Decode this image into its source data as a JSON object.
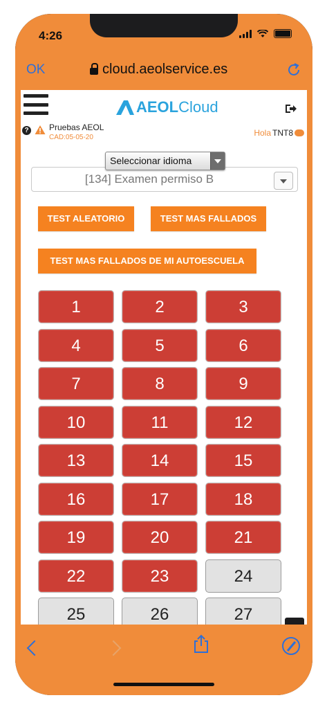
{
  "status_bar": {
    "time": "4:26"
  },
  "browser": {
    "ok_label": "OK",
    "url": "cloud.aeolservice.es"
  },
  "header": {
    "logo_text_bold": "AEOL",
    "logo_text_light": "Cloud",
    "school_name": "Pruebas AEOL",
    "cad": "CAD:05-05-20",
    "greeting": "Hola",
    "user": "TNT8"
  },
  "language_select": {
    "label": "Seleccionar idioma"
  },
  "exam_select": {
    "selected": "[134] Examen permiso B"
  },
  "buttons": {
    "random": "TEST ALEATORIO",
    "most_failed": "TEST MAS FALLADOS",
    "most_failed_school": "TEST MAS FALLADOS DE MI AUTOESCUELA"
  },
  "tests": [
    {
      "label": "1",
      "state": "failed"
    },
    {
      "label": "2",
      "state": "failed"
    },
    {
      "label": "3",
      "state": "failed"
    },
    {
      "label": "4",
      "state": "failed"
    },
    {
      "label": "5",
      "state": "failed"
    },
    {
      "label": "6",
      "state": "failed"
    },
    {
      "label": "7",
      "state": "failed"
    },
    {
      "label": "8",
      "state": "failed"
    },
    {
      "label": "9",
      "state": "failed"
    },
    {
      "label": "10",
      "state": "failed"
    },
    {
      "label": "11",
      "state": "failed"
    },
    {
      "label": "12",
      "state": "failed"
    },
    {
      "label": "13",
      "state": "failed"
    },
    {
      "label": "14",
      "state": "failed"
    },
    {
      "label": "15",
      "state": "failed"
    },
    {
      "label": "16",
      "state": "failed"
    },
    {
      "label": "17",
      "state": "failed"
    },
    {
      "label": "18",
      "state": "failed"
    },
    {
      "label": "19",
      "state": "failed"
    },
    {
      "label": "20",
      "state": "failed"
    },
    {
      "label": "21",
      "state": "failed"
    },
    {
      "label": "22",
      "state": "failed"
    },
    {
      "label": "23",
      "state": "failed"
    },
    {
      "label": "24",
      "state": "pending"
    },
    {
      "label": "25",
      "state": "pending"
    },
    {
      "label": "26",
      "state": "pending"
    },
    {
      "label": "27",
      "state": "pending"
    }
  ],
  "colors": {
    "accent": "#f08c3a",
    "failed": "#cc3e35",
    "pending": "#e2e2e2",
    "link": "#2e6fd8",
    "logo": "#2aa3dd"
  }
}
